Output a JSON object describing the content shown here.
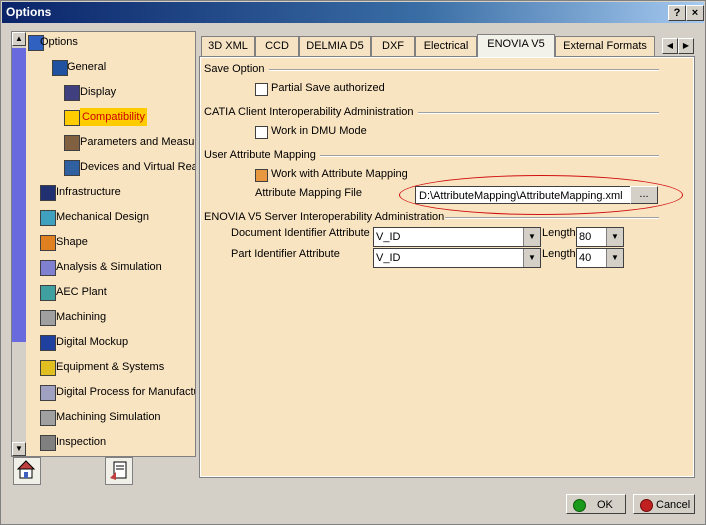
{
  "window": {
    "title": "Options",
    "help_btn": "?",
    "close_btn": "×"
  },
  "tree": {
    "items": [
      {
        "label": "Options",
        "icon": "options-icon"
      },
      {
        "label": "General",
        "icon": "general-icon"
      },
      {
        "label": "Display",
        "icon": "display-icon"
      },
      {
        "label": "Compatibility",
        "icon": "compatibility-icon"
      },
      {
        "label": "Parameters and Measure",
        "icon": "parameters-icon"
      },
      {
        "label": "Devices and Virtual Reality",
        "icon": "devices-icon"
      },
      {
        "label": "Infrastructure",
        "icon": "infrastructure-icon"
      },
      {
        "label": "Mechanical Design",
        "icon": "mechanical-icon"
      },
      {
        "label": "Shape",
        "icon": "shape-icon"
      },
      {
        "label": "Analysis & Simulation",
        "icon": "analysis-icon"
      },
      {
        "label": "AEC Plant",
        "icon": "aec-icon"
      },
      {
        "label": "Machining",
        "icon": "machining-icon"
      },
      {
        "label": "Digital Mockup",
        "icon": "mockup-icon"
      },
      {
        "label": "Equipment & Systems",
        "icon": "equipment-icon"
      },
      {
        "label": "Digital Process for Manufactu",
        "icon": "process-icon"
      },
      {
        "label": "Machining Simulation",
        "icon": "machsim-icon"
      },
      {
        "label": "Inspection",
        "icon": "inspection-icon"
      }
    ]
  },
  "tabs": [
    "3D XML",
    "CCD",
    "DELMIA D5",
    "DXF",
    "Electrical",
    "ENOVIA V5",
    "External Formats"
  ],
  "content": {
    "save_option": {
      "header": "Save Option",
      "partial_save": "Partial Save authorized"
    },
    "catia_client": {
      "header": "CATIA Client Interoperability Administration",
      "work_dmu": "Work in DMU Mode"
    },
    "user_attr": {
      "header": "User Attribute Mapping",
      "work_with": "Work with Attribute Mapping",
      "file_label": "Attribute Mapping File",
      "file_value": "D:\\AttributeMapping\\AttributeMapping.xml",
      "browse": "..."
    },
    "server": {
      "header": "ENOVIA V5 Server Interoperability Administration",
      "doc_label": "Document Identifier Attribute",
      "doc_value": "V_ID",
      "doc_length_label": "Length",
      "doc_length": "80",
      "part_label": "Part Identifier Attribute",
      "part_value": "V_ID",
      "part_length_label": "Length",
      "part_length": "40"
    }
  },
  "buttons": {
    "ok": "OK",
    "cancel": "Cancel"
  },
  "colors": {
    "title_start": "#0a246a",
    "panel_bg": "#f9e4c2",
    "selection": "#ffcc00",
    "highlight_ellipse": "#d01010"
  }
}
